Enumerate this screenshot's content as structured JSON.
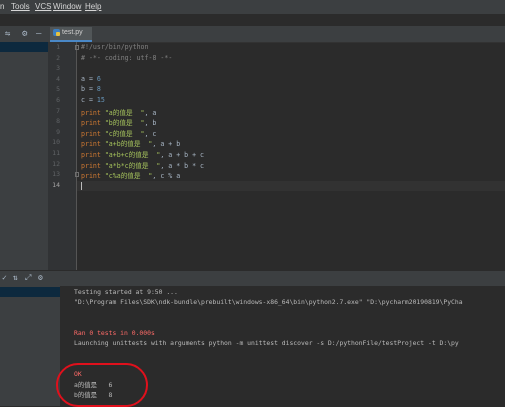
{
  "menu": [
    "n",
    "Tools",
    "VCS",
    "Window",
    "Help"
  ],
  "toolbar_icons": {
    "settings": "⚙",
    "minimize": "—"
  },
  "tab": {
    "label": "test.py"
  },
  "editor": {
    "lines": [
      {
        "n": "1",
        "parts": [
          {
            "t": "#!/usr/bin/python",
            "c": "cm"
          }
        ]
      },
      {
        "n": "2",
        "parts": [
          {
            "t": "# -*- coding: utf-8 -*-",
            "c": "cm"
          }
        ]
      },
      {
        "n": "3",
        "parts": []
      },
      {
        "n": "4",
        "parts": [
          {
            "t": "a = ",
            "c": ""
          },
          {
            "t": "6",
            "c": "num"
          }
        ]
      },
      {
        "n": "5",
        "parts": [
          {
            "t": "b = ",
            "c": ""
          },
          {
            "t": "8",
            "c": "num"
          }
        ]
      },
      {
        "n": "6",
        "parts": [
          {
            "t": "c = ",
            "c": ""
          },
          {
            "t": "15",
            "c": "num"
          }
        ]
      },
      {
        "n": "7",
        "parts": [
          {
            "t": "print ",
            "c": "kw"
          },
          {
            "t": "\"a的值是  \"",
            "c": "str"
          },
          {
            "t": ", a",
            "c": ""
          }
        ]
      },
      {
        "n": "8",
        "parts": [
          {
            "t": "print ",
            "c": "kw"
          },
          {
            "t": "\"b的值是  \"",
            "c": "str"
          },
          {
            "t": ", b",
            "c": ""
          }
        ]
      },
      {
        "n": "9",
        "parts": [
          {
            "t": "print ",
            "c": "kw"
          },
          {
            "t": "\"c的值是  \"",
            "c": "str"
          },
          {
            "t": ", c",
            "c": ""
          }
        ]
      },
      {
        "n": "10",
        "parts": [
          {
            "t": "print ",
            "c": "kw"
          },
          {
            "t": "\"a+b的值是  \"",
            "c": "str"
          },
          {
            "t": ", a + b",
            "c": ""
          }
        ]
      },
      {
        "n": "11",
        "parts": [
          {
            "t": "print ",
            "c": "kw"
          },
          {
            "t": "\"a+b+c的值是  \"",
            "c": "str"
          },
          {
            "t": ", a + b + c",
            "c": ""
          }
        ]
      },
      {
        "n": "12",
        "parts": [
          {
            "t": "print ",
            "c": "kw"
          },
          {
            "t": "\"a*b*c的值是  \"",
            "c": "str"
          },
          {
            "t": ", a * b * c",
            "c": ""
          }
        ]
      },
      {
        "n": "13",
        "parts": [
          {
            "t": "print ",
            "c": "kw"
          },
          {
            "t": "\"c%a的值是  \"",
            "c": "str"
          },
          {
            "t": ", c % a",
            "c": ""
          }
        ]
      },
      {
        "n": "14",
        "parts": []
      }
    ]
  },
  "console": {
    "lines": [
      {
        "t": "Testing started at 9:50 ...",
        "c": ""
      },
      {
        "t": "\"D:\\Program Files\\SDK\\ndk-bundle\\prebuilt\\windows-x86_64\\bin\\python2.7.exe\" \"D:\\pycharm20190819\\PyCha",
        "c": ""
      },
      {
        "t": "",
        "c": ""
      },
      {
        "t": "",
        "c": ""
      },
      {
        "t": "Ran 0 tests in 0.000s",
        "c": "err"
      },
      {
        "t": "Launching unittests with arguments python -m unittest discover -s D:/pythonFile/testProject -t D:\\py",
        "c": ""
      },
      {
        "t": "",
        "c": ""
      },
      {
        "t": "",
        "c": ""
      },
      {
        "t": "OK",
        "c": "err"
      },
      {
        "t": "a的值是   6",
        "c": ""
      },
      {
        "t": "b的值是   8",
        "c": ""
      }
    ]
  }
}
